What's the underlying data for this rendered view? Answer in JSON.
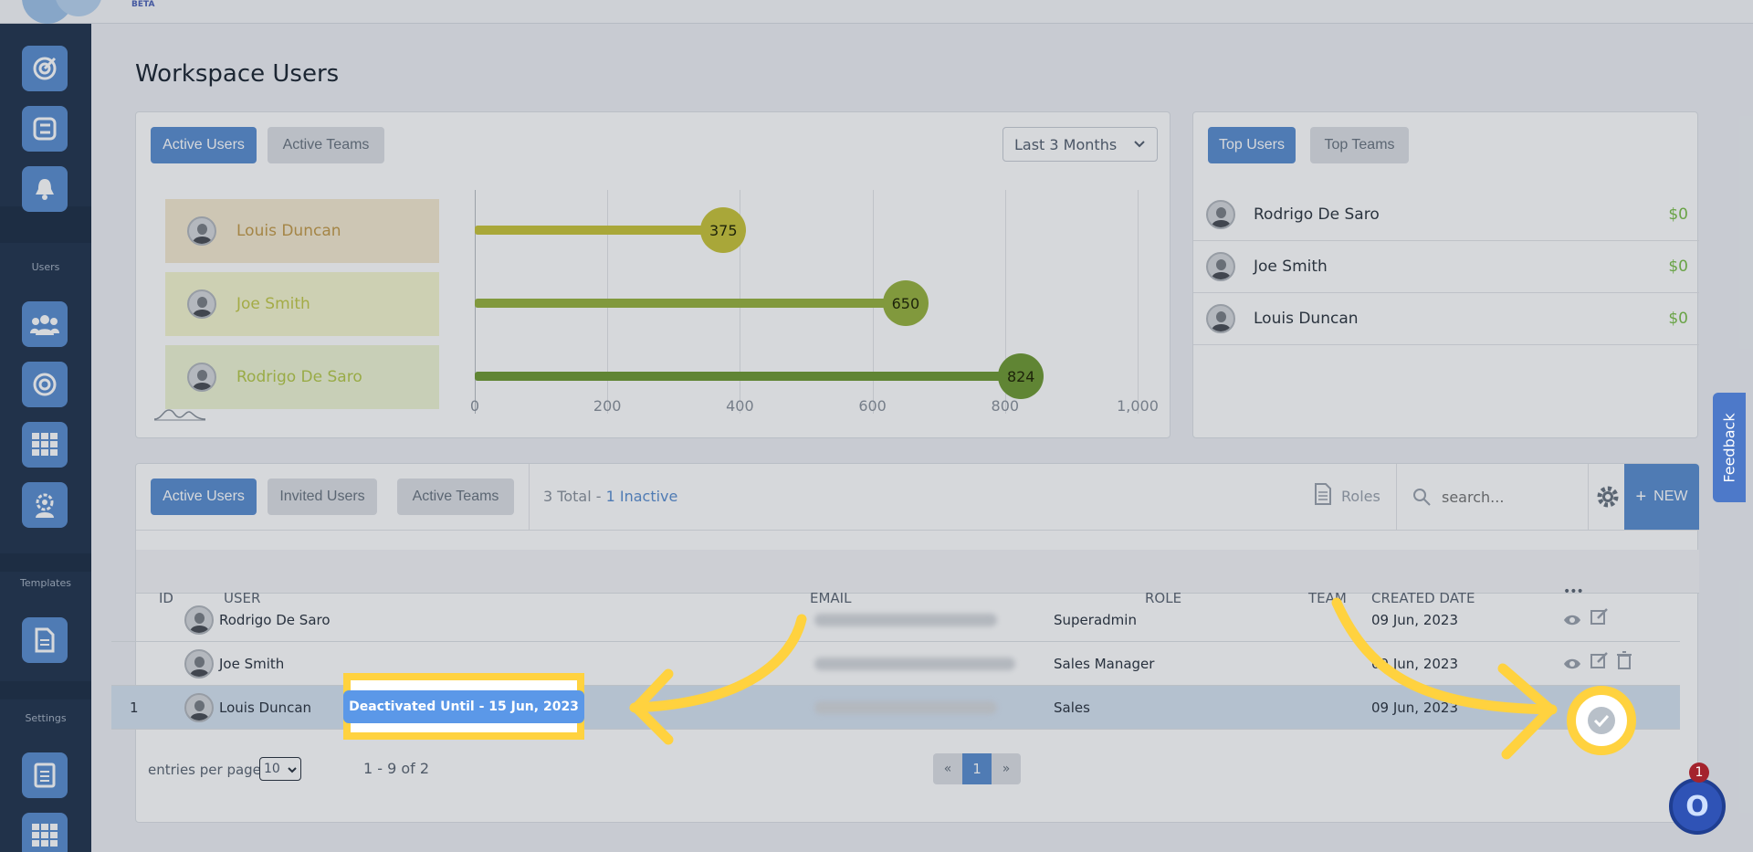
{
  "app": {
    "beta_label": "BETA"
  },
  "sidebar": {
    "sections": [
      {
        "label": "Users"
      },
      {
        "label": "Templates"
      },
      {
        "label": "Settings"
      }
    ],
    "icons": [
      "target-icon",
      "checklist-icon",
      "bell-icon",
      "users-icon",
      "goal-icon",
      "grid-icon",
      "team-settings-icon",
      "document-icon",
      "report-icon",
      "grid-icon"
    ]
  },
  "page": {
    "title": "Workspace Users"
  },
  "chart_panel": {
    "tabs": [
      "Active Users",
      "Active Teams"
    ],
    "period": "Last 3 Months"
  },
  "chart_data": {
    "type": "bar",
    "orientation": "horizontal",
    "categories": [
      "Louis Duncan",
      "Joe Smith",
      "Rodrigo De Saro"
    ],
    "values": [
      375,
      650,
      824
    ],
    "xlim": [
      0,
      1000
    ],
    "xticks": [
      "0",
      "200",
      "400",
      "600",
      "800",
      "1,000"
    ],
    "colors": [
      "#c9c43a",
      "#98b33f",
      "#6f9a34"
    ],
    "legend_fills": [
      "#f5ead0",
      "#f4f6cf",
      "#eef5d4"
    ],
    "legend_text_colors": [
      "#c39a4a",
      "#c2c94a",
      "#b5c94a"
    ],
    "grid": true
  },
  "top_panel": {
    "tabs": [
      "Top Users",
      "Top Teams"
    ],
    "users": [
      {
        "name": "Rodrigo De Saro",
        "value": "$0"
      },
      {
        "name": "Joe Smith",
        "value": "$0"
      },
      {
        "name": "Louis Duncan",
        "value": "$0"
      }
    ]
  },
  "table_panel": {
    "tabs": [
      "Active Users",
      "Invited Users",
      "Active Teams"
    ],
    "summary": {
      "total": "3 Total",
      "sep": "-",
      "inactive": "1 Inactive"
    },
    "roles_label": "Roles",
    "search_placeholder": "search...",
    "new_label": "NEW",
    "columns": [
      "ID",
      "USER",
      "EMAIL",
      "ROLE",
      "TEAM",
      "CREATED DATE"
    ],
    "more_label": "•••",
    "rows": [
      {
        "id": "",
        "user": "Rodrigo De Saro",
        "role": "Superadmin",
        "team": "",
        "created": "09 Jun, 2023"
      },
      {
        "id": "",
        "user": "Joe Smith",
        "role": "Sales Manager",
        "team": "",
        "created": "09 Jun, 2023"
      },
      {
        "id": "1",
        "user": "Louis Duncan",
        "role": "Sales",
        "team": "",
        "created": "09 Jun, 2023"
      }
    ],
    "deactivated_badge": "Deactivated Until - 15 Jun, 2023",
    "entries_label": "entries per page",
    "entries_value": "10",
    "range_text": "1 - 9 of 2",
    "pagination": {
      "prev": "«",
      "current": "1",
      "next": "»"
    }
  },
  "feedback_label": "Feedback",
  "chat": {
    "badge": "1",
    "glyph": "O"
  },
  "highlight_color": "#ffd23f"
}
